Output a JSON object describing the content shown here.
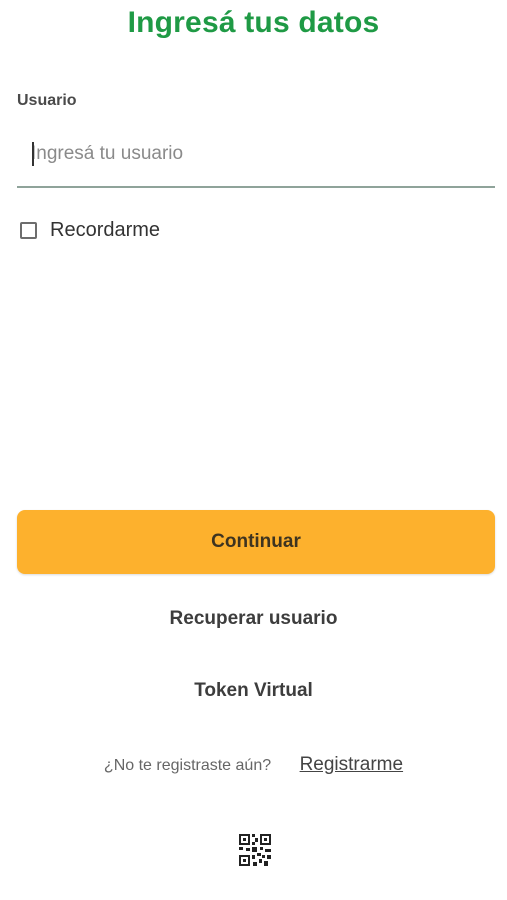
{
  "header": {
    "title": "Ingresá tus datos"
  },
  "form": {
    "user_label": "Usuario",
    "user_value": "",
    "user_placeholder": "Ingresá tu usuario",
    "remember_label": "Recordarme",
    "remember_checked": false
  },
  "actions": {
    "continue_label": "Continuar",
    "recover_label": "Recuperar usuario",
    "token_label": "Token Virtual"
  },
  "register": {
    "question": "¿No te registraste aún?",
    "link_label": "Registrarme"
  },
  "icons": {
    "qr": "qr-code-icon"
  },
  "colors": {
    "title": "#1f9a45",
    "primary_button": "#fdb12d",
    "input_underline": "#8fa39a"
  }
}
